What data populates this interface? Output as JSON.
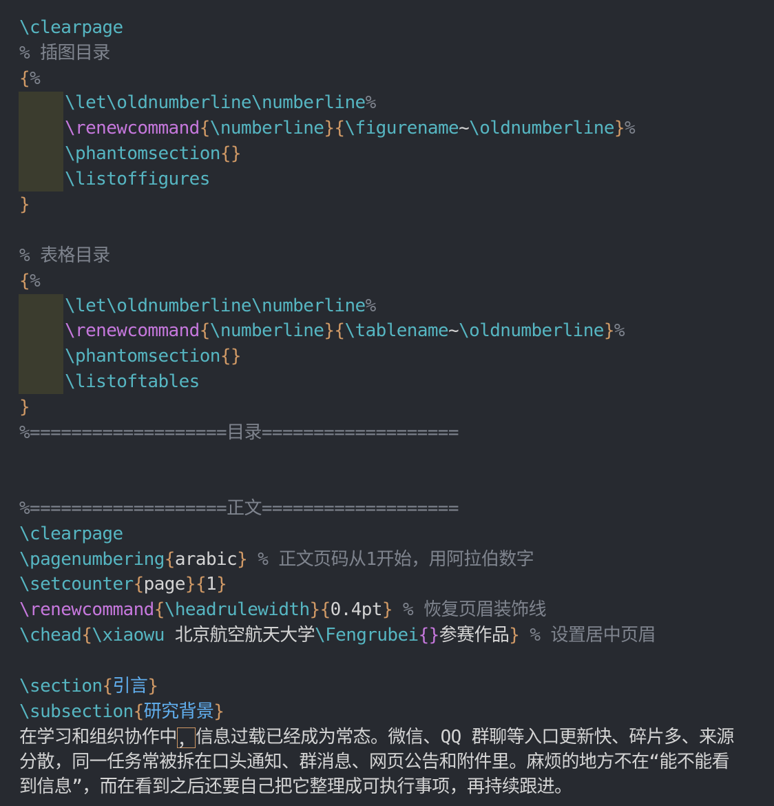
{
  "editor": {
    "lines": [
      "\\clearpage",
      "% 插图目录",
      "{%",
      "\\let\\oldnumberline\\numberline%",
      "\\renewcommand{\\numberline}{\\figurename~\\oldnumberline}%",
      "\\phantomsection{}",
      "\\listoffigures%",
      "}",
      "% 表格目录",
      "{%",
      "\\let\\oldnumberline\\numberline%",
      "\\renewcommand{\\numberline}{\\tablename~\\oldnumberline}%",
      "\\phantomsection{}",
      "\\listoftables",
      "}",
      "%===================目录===================",
      "%===================正文===================",
      "\\clearpage",
      "\\pagenumbering{arabic} % 正文页码从1开始，用阿拉伯数字",
      "\\setcounter{page}{1}",
      "\\renewcommand{\\headrulewidth}{0.4pt} % 恢复页眉装饰线",
      "\\chead{\\xiaowu 北京航空航天大学\\Fengrubei{}参赛作品} % 设置居中页眉",
      "\\section{引言}",
      "\\subsection{研究背景}",
      "在学习和组织协作中，信息过载已经成为常态。微信、QQ 群聊等入口更新快、碎片多、来源",
      "分散，同一任务常被拆在口头通知、群消息、网页公告和附件里。麻烦的地方不在“能不能看",
      "到信息”，而在看到之后还要自己把它整理成可执行事项，再持续跟进。"
    ]
  },
  "tokens": {
    "clearpage": "\\clearpage",
    "c_fig": "% 插图目录",
    "c_tab": "% 表格目录",
    "brace_open": "{",
    "brace_close": "}",
    "pct": "%",
    "let": "\\let",
    "oldnumberline": "\\oldnumberline",
    "numberline": "\\numberline",
    "renewcommand": "\\renewcommand",
    "figurename": "\\figurename",
    "tablename": "\\tablename",
    "tilde": "~",
    "phantomsection": "\\phantomsection",
    "empty_braces": "{}",
    "listoffigures": "\\listoffigures",
    "listoftables": "\\listoftables",
    "sep_toc": "%===================目录===================",
    "sep_body": "%===================正文===================",
    "pagenumbering": "\\pagenumbering",
    "arabic": "arabic",
    "c_pagenum": " % 正文页码从1开始，用阿拉伯数字",
    "setcounter": "\\setcounter",
    "page": "page",
    "one": "1",
    "headrulewidth": "\\headrulewidth",
    "pt": "0.4pt",
    "c_headrule": " % 恢复页眉装饰线",
    "chead": "\\chead",
    "xiaowu": "\\xiaowu",
    "school": " 北京航空航天大学",
    "fengrubei": "\\Fengrubei",
    "entry": "参赛作品",
    "c_chead": " % 设置居中页眉",
    "section": "\\section",
    "intro": "引言",
    "subsection": "\\subsection",
    "bg": "研究背景",
    "p1a": "在学习和组织协作中",
    "p1comma": "，",
    "p1b": "信息过载已经成为常态。微信、QQ 群聊等入口更新快、碎片多、来源",
    "p2": "分散，同一任务常被拆在口头通知、群消息、网页公告和附件里。麻烦的地方不在“能不能看",
    "p3": "到信息”，而在看到之后还要自己把它整理成可执行事项，再持续跟进。"
  },
  "colors": {
    "background": "#272a30",
    "command": "#56b6c2",
    "command_alt": "#c678dd",
    "brace": "#d19a66",
    "comment": "#7f848e",
    "heading_text": "#61afef",
    "plain_text": "#d4d4d4",
    "indent_guide": "#3b3c2e"
  }
}
